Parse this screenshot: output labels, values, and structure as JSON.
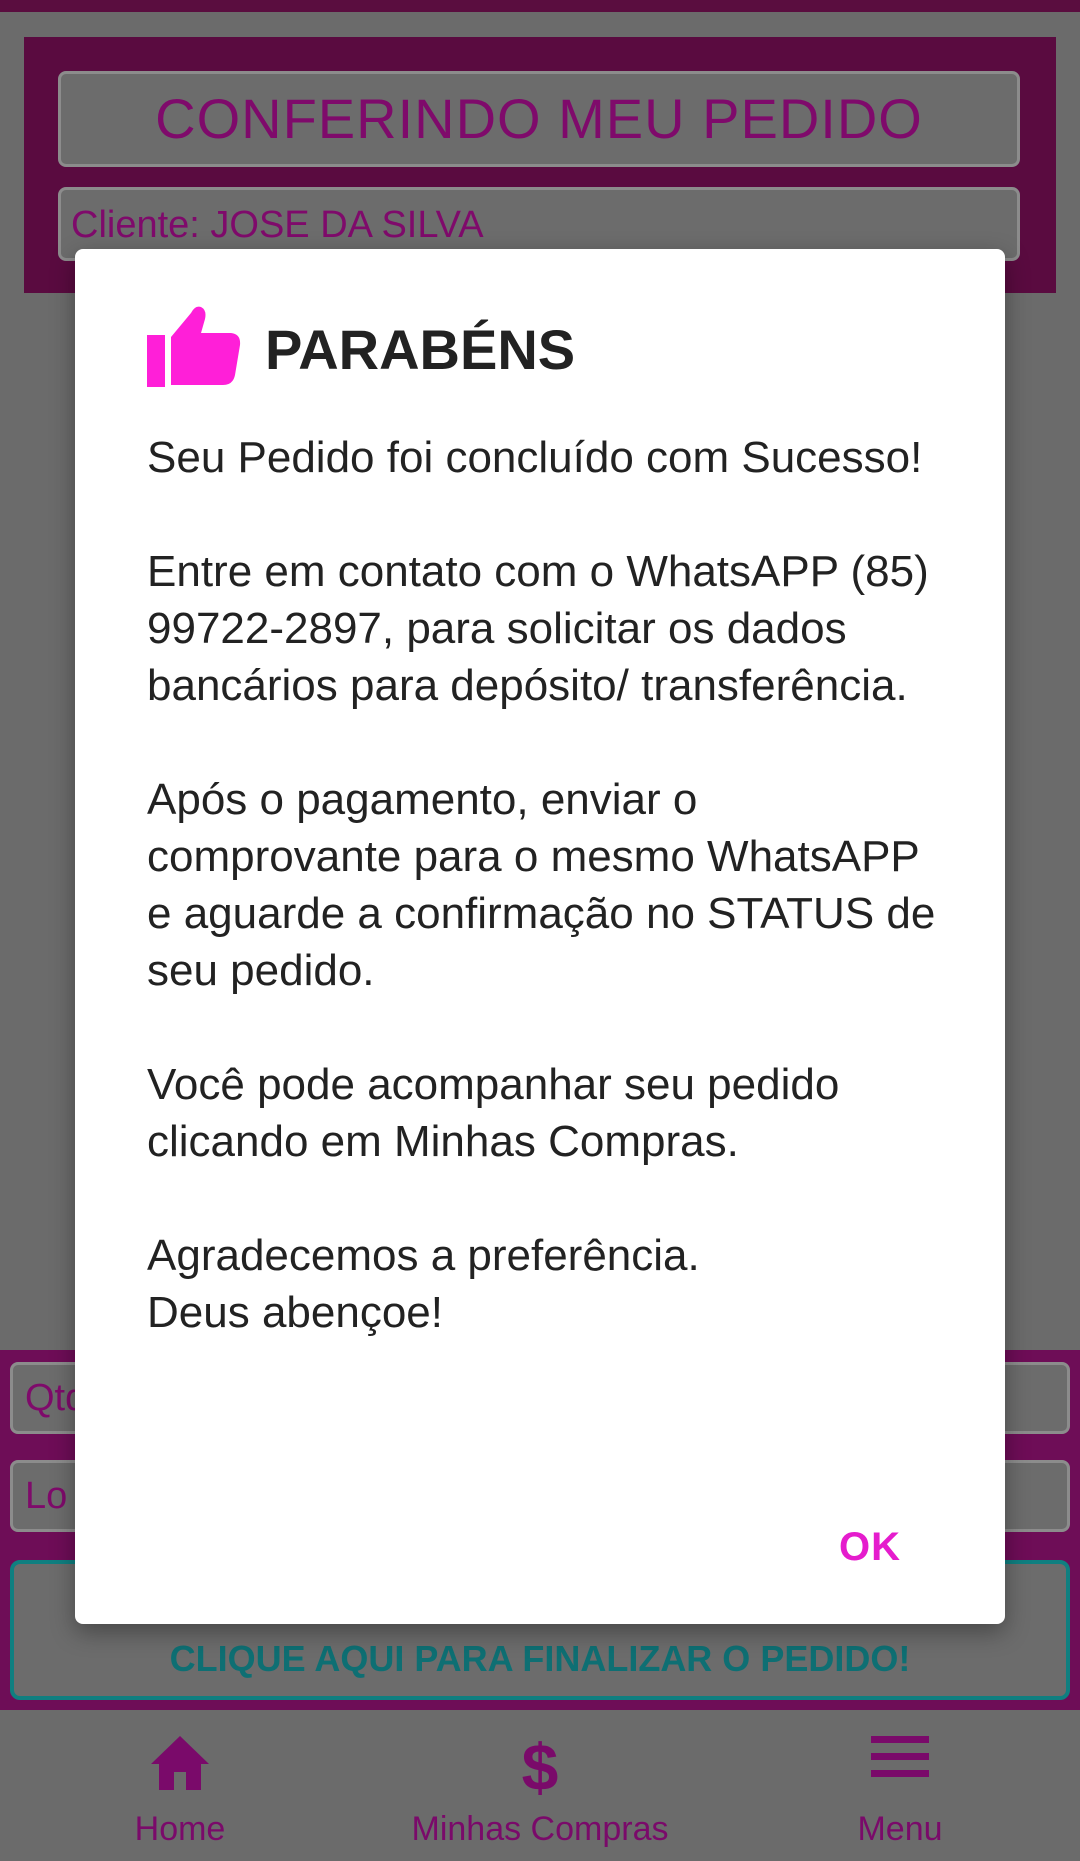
{
  "colors": {
    "accent_magenta": "#e51ccd",
    "header_purple": "#5a0b40",
    "teal_border": "#0f7f80",
    "scrim_gray": "#6b6b6b"
  },
  "background": {
    "header": {
      "title": "CONFERINDO MEU PEDIDO",
      "client": "Cliente: JOSE DA SILVA"
    },
    "form": {
      "qty_placeholder": "Qtd",
      "loc_placeholder": "Lo",
      "finish_button": "CLIQUE AQUI PARA FINALIZAR O PEDIDO!"
    },
    "nav": [
      {
        "label": "Home",
        "icon": "home-icon"
      },
      {
        "label": "Minhas Compras",
        "icon": "dollar-icon"
      },
      {
        "label": "Menu",
        "icon": "hamburger-menu-icon"
      }
    ]
  },
  "dialog": {
    "icon": "thumbs-up-icon",
    "title": "PARABÉNS",
    "paragraphs": [
      "Seu Pedido foi concluído com Sucesso!",
      "Entre em contato com o WhatsAPP (85) 99722-2897, para solicitar os dados bancários para depósito/ transferência.",
      "Após o pagamento, enviar o comprovante para o mesmo WhatsAPP e aguarde a confirmação no STATUS de seu pedido.",
      "Você pode acompanhar seu pedido clicando em Minhas Compras."
    ],
    "closing_lines": [
      "Agradecemos a preferência.",
      "Deus abençoe!"
    ],
    "ok_label": "OK"
  }
}
